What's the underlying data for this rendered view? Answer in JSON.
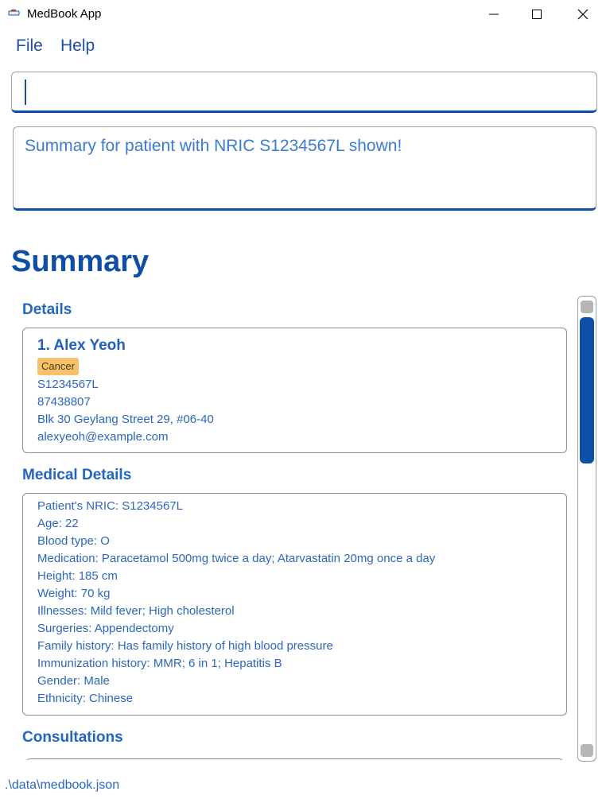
{
  "window": {
    "title": "MedBook App",
    "icon": "app-icon"
  },
  "menu": {
    "file": "File",
    "help": "Help"
  },
  "command": {
    "value": "",
    "placeholder": ""
  },
  "result": {
    "text": "Summary for patient with NRIC S1234567L shown!"
  },
  "summary": {
    "title": "Summary",
    "details": {
      "title": "Details",
      "name": "1.  Alex Yeoh",
      "tag": "Cancer",
      "tag_color": "#f5c26b",
      "nric": "S1234567L",
      "phone": "87438807",
      "address": "Blk 30 Geylang Street 29, #06-40",
      "email": "alexyeoh@example.com"
    },
    "medical": {
      "title": "Medical Details",
      "lines": [
        "Patient's NRIC: S1234567L",
        "Age: 22",
        "Blood type: O",
        "Medication: Paracetamol 500mg twice a day; Atarvastatin 20mg once a day",
        "Height: 185 cm",
        "Weight: 70 kg",
        "Illnesses: Mild fever; High cholesterol",
        "Surgeries: Appendectomy",
        "Family history: Has family history of high blood pressure",
        "Immunization history: MMR; 6 in 1; Hepatitis B",
        "Gender: Male",
        "Ethnicity: Chinese"
      ]
    },
    "consultations": {
      "title": "Consultations"
    }
  },
  "status": {
    "path": ".\\data\\medbook.json"
  },
  "colors": {
    "accent": "#0d4fa6",
    "text": "#2b67c0"
  }
}
